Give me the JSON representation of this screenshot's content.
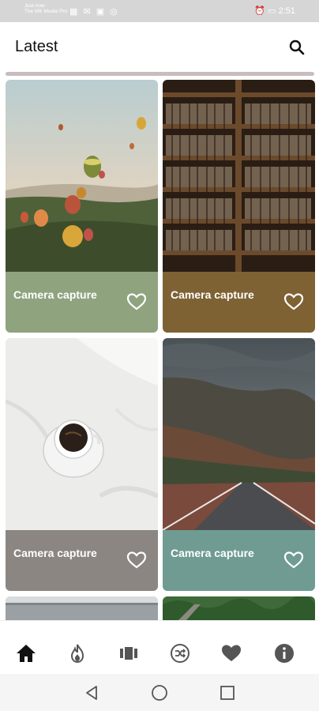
{
  "status_bar": {
    "left_line1": "Just now",
    "left_line2": "The MK Media Pro",
    "time": "2:51"
  },
  "app_bar": {
    "title": "Latest"
  },
  "cards": [
    {
      "caption": "Camera capture",
      "bar_color": "#8fa37f",
      "photo": "hot-air-balloons"
    },
    {
      "caption": "Camera capture",
      "bar_color": "#7e6234",
      "photo": "bookshelves"
    },
    {
      "caption": "Camera capture",
      "bar_color": "#8c8683",
      "photo": "coffee-cup-on-bed"
    },
    {
      "caption": "Camera capture",
      "bar_color": "#6f9b93",
      "photo": "mountain-road"
    }
  ],
  "bottom_nav": [
    "home-icon",
    "fire-icon",
    "gallery-icon",
    "shuffle-icon",
    "heart-icon",
    "info-icon"
  ],
  "system_nav": [
    "back-icon",
    "home-circle-icon",
    "recents-icon"
  ]
}
